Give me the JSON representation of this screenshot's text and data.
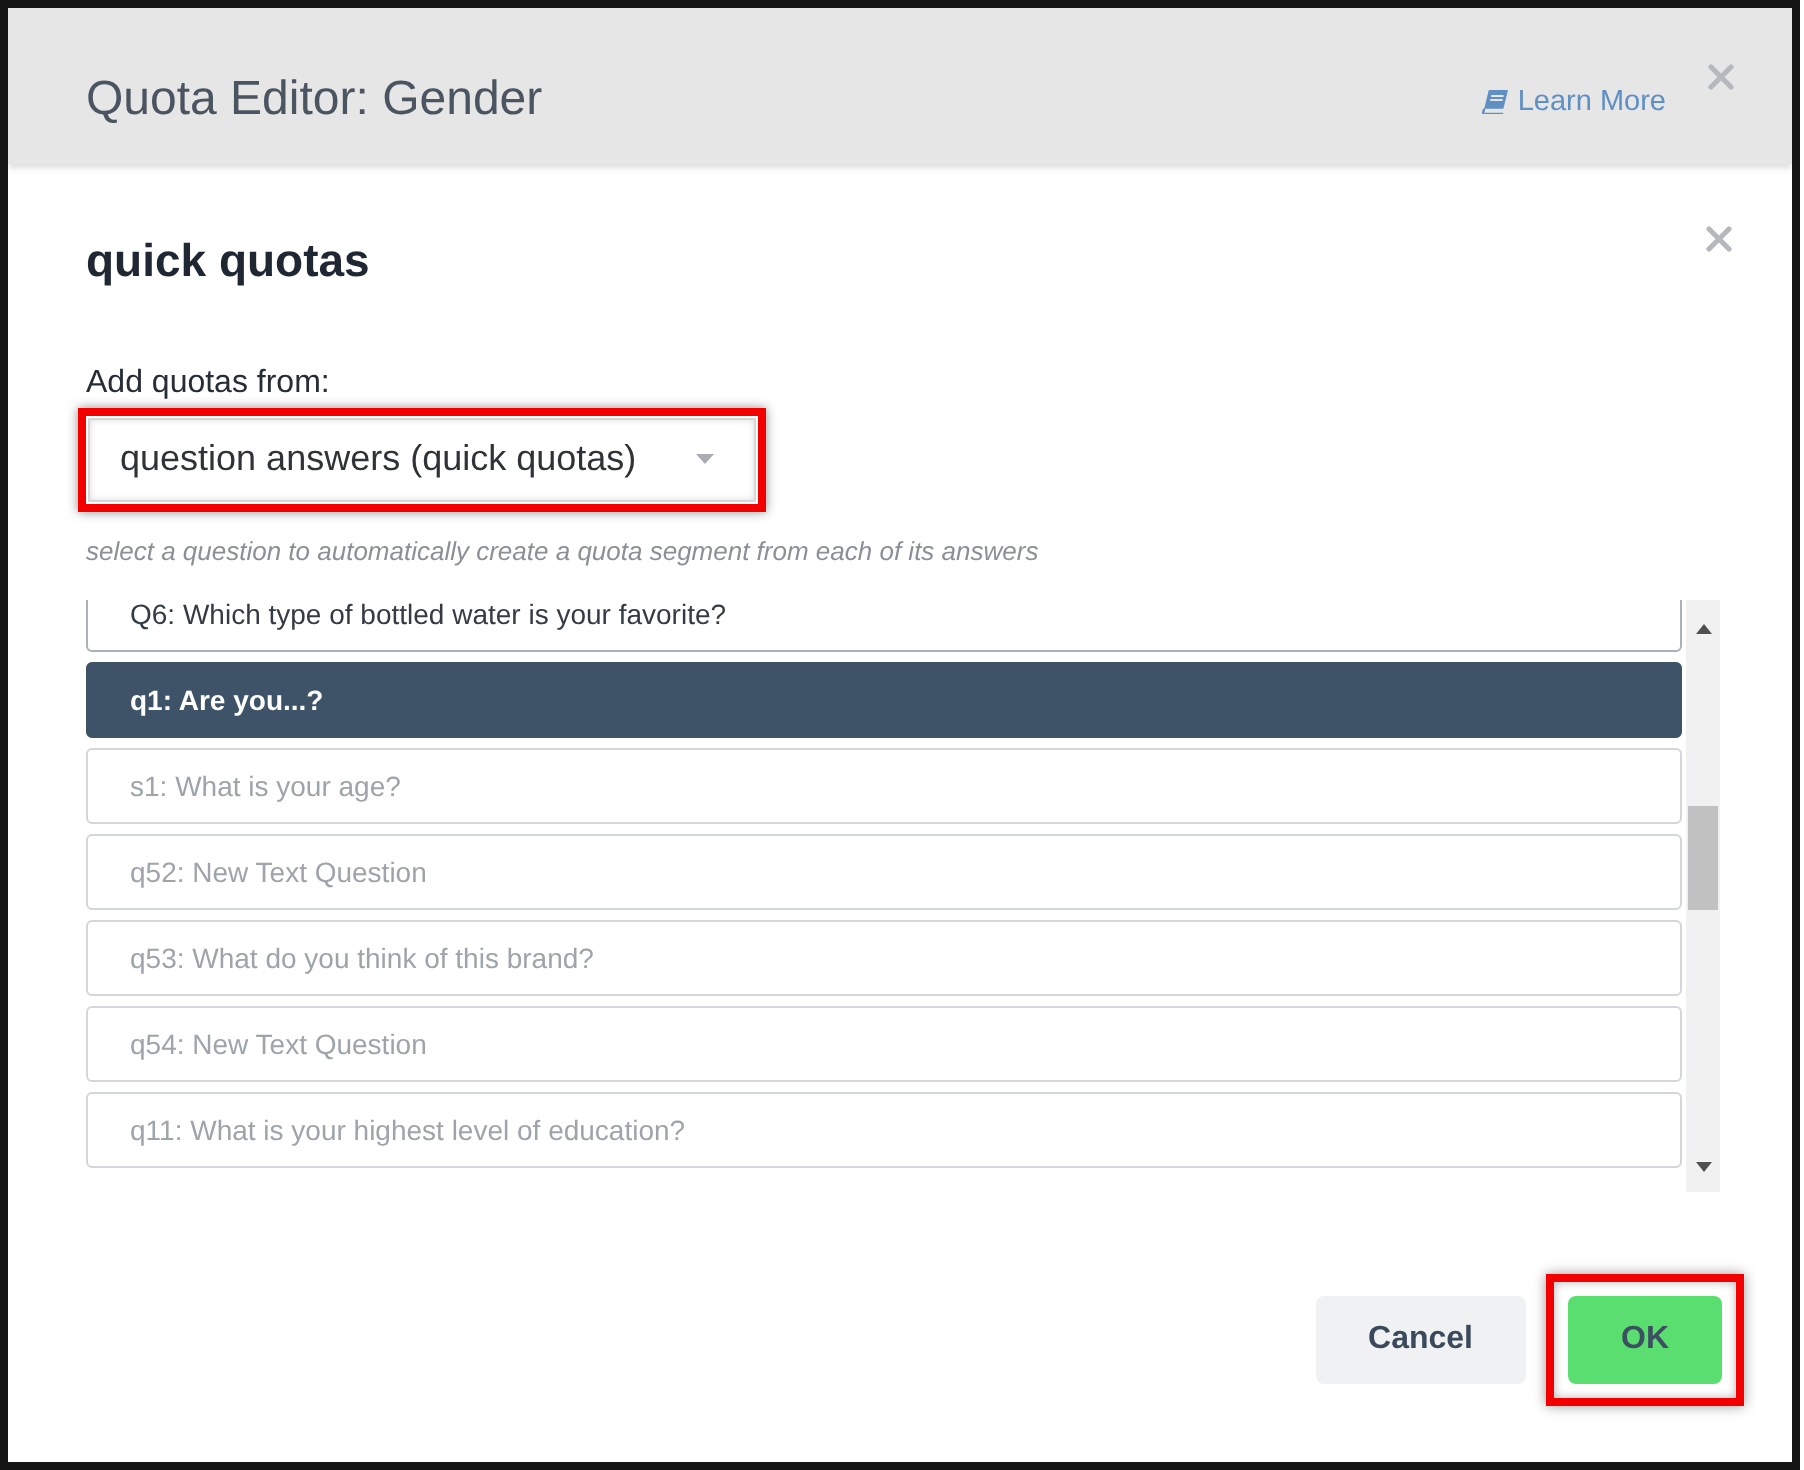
{
  "dialog": {
    "title": "Quota Editor: Gender",
    "help_link": "Learn More"
  },
  "panel": {
    "title": "quick quotas",
    "source_label": "Add quotas from:",
    "source_dropdown": {
      "value": "question answers (quick quotas)",
      "highlighted": true
    },
    "hint": "select a question to automatically create a quota segment from each of its answers"
  },
  "questions": [
    {
      "label": "Q6: Which type of bottled water is your favorite?",
      "selected": false,
      "disabled": false
    },
    {
      "label": "q1: Are you...?",
      "selected": true,
      "disabled": false
    },
    {
      "label": "s1: What is your age?",
      "selected": false,
      "disabled": true
    },
    {
      "label": "q52: New Text Question",
      "selected": false,
      "disabled": true
    },
    {
      "label": "q53: What do you think of this brand?",
      "selected": false,
      "disabled": true
    },
    {
      "label": "q54: New Text Question",
      "selected": false,
      "disabled": true
    },
    {
      "label": "q11: What is your highest level of education?",
      "selected": false,
      "disabled": true
    }
  ],
  "buttons": [
    {
      "label": "Cancel",
      "kind": "cancel",
      "highlighted": false
    },
    {
      "label": "OK",
      "kind": "confirm",
      "highlighted": true
    }
  ]
}
